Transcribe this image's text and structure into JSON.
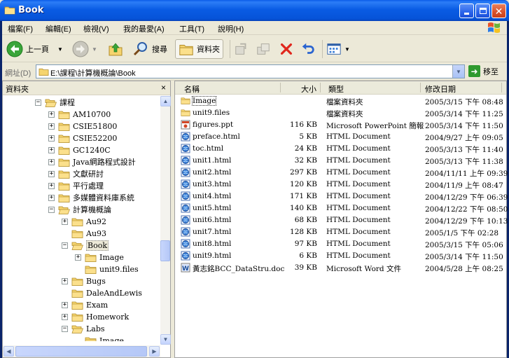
{
  "window": {
    "title": "Book",
    "buttons": [
      "minimize",
      "maximize",
      "close"
    ]
  },
  "menu": [
    "檔案(F)",
    "編輯(E)",
    "檢視(V)",
    "我的最愛(A)",
    "工具(T)",
    "說明(H)"
  ],
  "toolbar": {
    "back_label": "上一頁",
    "search_label": "搜尋",
    "folders_label": "資料夾"
  },
  "address": {
    "label": "網址(D)",
    "value": "E:\\課程\\計算機概論\\Book",
    "go_label": "移至"
  },
  "folders_pane": {
    "title": "資料夾",
    "close": "×",
    "tree": [
      {
        "label": "課程",
        "level": 0,
        "expander": "−"
      },
      {
        "label": "AM10700",
        "level": 1,
        "expander": "+"
      },
      {
        "label": "CSIE51800",
        "level": 1,
        "expander": "+"
      },
      {
        "label": "CSIE52200",
        "level": 1,
        "expander": "+"
      },
      {
        "label": "GC1240C",
        "level": 1,
        "expander": "+"
      },
      {
        "label": "Java網路程式設計",
        "level": 1,
        "expander": "+"
      },
      {
        "label": "文獻研討",
        "level": 1,
        "expander": "+"
      },
      {
        "label": "平行處理",
        "level": 1,
        "expander": "+"
      },
      {
        "label": "多媒體資料庫系統",
        "level": 1,
        "expander": "+"
      },
      {
        "label": "計算機概論",
        "level": 1,
        "expander": "−"
      },
      {
        "label": "Au92",
        "level": 2,
        "expander": "+"
      },
      {
        "label": "Au93",
        "level": 2,
        "expander": ""
      },
      {
        "label": "Book",
        "level": 2,
        "expander": "−",
        "selected": true
      },
      {
        "label": "Image",
        "level": 3,
        "expander": "+"
      },
      {
        "label": "unit9.files",
        "level": 3,
        "expander": ""
      },
      {
        "label": "Bugs",
        "level": 2,
        "expander": "+"
      },
      {
        "label": "DaleAndLewis",
        "level": 2,
        "expander": ""
      },
      {
        "label": "Exam",
        "level": 2,
        "expander": "+"
      },
      {
        "label": "Homework",
        "level": 2,
        "expander": "+"
      },
      {
        "label": "Labs",
        "level": 2,
        "expander": "−"
      },
      {
        "label": "Image",
        "level": 3,
        "expander": ""
      }
    ]
  },
  "columns": {
    "name": "名稱",
    "size": "大小",
    "type": "類型",
    "modified": "修改日期"
  },
  "files": [
    {
      "icon": "folder",
      "name": "Image",
      "size": "",
      "type": "檔案資料夾",
      "date": "2005/3/15 下午 08:48"
    },
    {
      "icon": "folder",
      "name": "unit9.files",
      "size": "",
      "type": "檔案資料夾",
      "date": "2005/3/14 下午 11:25"
    },
    {
      "icon": "ppt",
      "name": "figures.ppt",
      "size": "116 KB",
      "type": "Microsoft PowerPoint 簡報",
      "date": "2005/3/14 下午 11:50"
    },
    {
      "icon": "html",
      "name": "preface.html",
      "size": "5 KB",
      "type": "HTML Document",
      "date": "2004/9/27 上午 09:05"
    },
    {
      "icon": "html",
      "name": "toc.html",
      "size": "24 KB",
      "type": "HTML Document",
      "date": "2005/3/13 下午 11:40"
    },
    {
      "icon": "html",
      "name": "unit1.html",
      "size": "32 KB",
      "type": "HTML Document",
      "date": "2005/3/13 下午 11:38"
    },
    {
      "icon": "html",
      "name": "unit2.html",
      "size": "297 KB",
      "type": "HTML Document",
      "date": "2004/11/11 上午 09:39"
    },
    {
      "icon": "html",
      "name": "unit3.html",
      "size": "120 KB",
      "type": "HTML Document",
      "date": "2004/11/9 上午 08:47"
    },
    {
      "icon": "html",
      "name": "unit4.html",
      "size": "171 KB",
      "type": "HTML Document",
      "date": "2004/12/29 下午 06:39"
    },
    {
      "icon": "html",
      "name": "unit5.html",
      "size": "140 KB",
      "type": "HTML Document",
      "date": "2004/12/22 下午 08:50"
    },
    {
      "icon": "html",
      "name": "unit6.html",
      "size": "68 KB",
      "type": "HTML Document",
      "date": "2004/12/29 下午 10:13"
    },
    {
      "icon": "html",
      "name": "unit7.html",
      "size": "128 KB",
      "type": "HTML Document",
      "date": "2005/1/5 下午 02:28"
    },
    {
      "icon": "html",
      "name": "unit8.html",
      "size": "97 KB",
      "type": "HTML Document",
      "date": "2005/3/15 下午 05:06"
    },
    {
      "icon": "html",
      "name": "unit9.html",
      "size": "6 KB",
      "type": "HTML Document",
      "date": "2005/3/14 下午 11:50"
    },
    {
      "icon": "doc",
      "name": "黃志銘BCC_DataStru.doc",
      "size": "39 KB",
      "type": "Microsoft Word 文件",
      "date": "2004/5/28 上午 08:25"
    }
  ],
  "colors": {
    "titlebar": "#0a5ce4",
    "folder": "#f5d46e",
    "selection": "#ece9d8"
  }
}
